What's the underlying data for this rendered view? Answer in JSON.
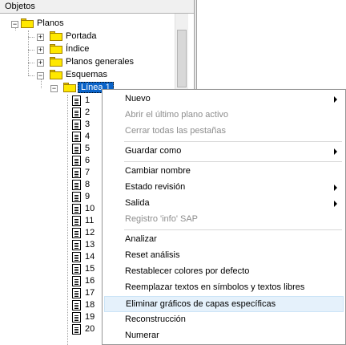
{
  "panel": {
    "title": "Objetos"
  },
  "tree": {
    "root": "Planos",
    "children": [
      "Portada",
      "Índice",
      "Planos generales",
      "Esquemas"
    ],
    "expanded_child": "Línea 1",
    "docs": [
      "1",
      "2",
      "3",
      "4",
      "5",
      "6",
      "7",
      "8",
      "9",
      "10",
      "11",
      "12",
      "13",
      "14",
      "15",
      "16",
      "17",
      "18",
      "19",
      "20"
    ]
  },
  "context_menu": {
    "items": [
      {
        "label": "Nuevo",
        "submenu": true,
        "disabled": false
      },
      {
        "label": "Abrir el último plano activo",
        "submenu": false,
        "disabled": true
      },
      {
        "label": "Cerrar todas las pestañas",
        "submenu": false,
        "disabled": true
      },
      {
        "label": "Guardar como",
        "submenu": true,
        "disabled": false
      },
      {
        "label": "Cambiar nombre",
        "submenu": false,
        "disabled": false
      },
      {
        "label": "Estado revisión",
        "submenu": true,
        "disabled": false
      },
      {
        "label": "Salida",
        "submenu": true,
        "disabled": false
      },
      {
        "label": "Registro 'info' SAP",
        "submenu": false,
        "disabled": true
      },
      {
        "label": "Analizar",
        "submenu": false,
        "disabled": false
      },
      {
        "label": "Reset análisis",
        "submenu": false,
        "disabled": false
      },
      {
        "label": "Restablecer colores por defecto",
        "submenu": false,
        "disabled": false
      },
      {
        "label": "Reemplazar textos en símbolos y textos libres",
        "submenu": false,
        "disabled": false
      },
      {
        "label": "Eliminar gráficos de capas específicas",
        "submenu": false,
        "disabled": false,
        "highlighted": true
      },
      {
        "label": "Reconstrucción",
        "submenu": false,
        "disabled": false
      },
      {
        "label": "Numerar",
        "submenu": false,
        "disabled": false
      }
    ]
  },
  "colors": {
    "selection": "#0a63c8",
    "folder": "#ffe800",
    "menu_hover": "#e5f1fb"
  }
}
